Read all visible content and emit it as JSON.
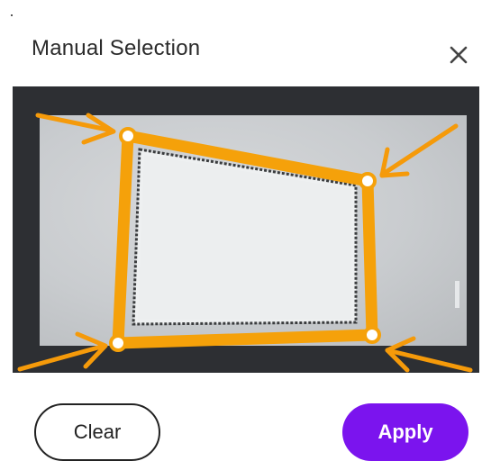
{
  "dialog": {
    "title": "Manual Selection",
    "close_icon": "close-icon"
  },
  "preview": {
    "handle_color": "#f5a10a",
    "arrow_color": "#f59a0a",
    "frame_background": "#2d2f33"
  },
  "actions": {
    "clear_label": "Clear",
    "apply_label": "Apply",
    "apply_color": "#7b14ee"
  }
}
